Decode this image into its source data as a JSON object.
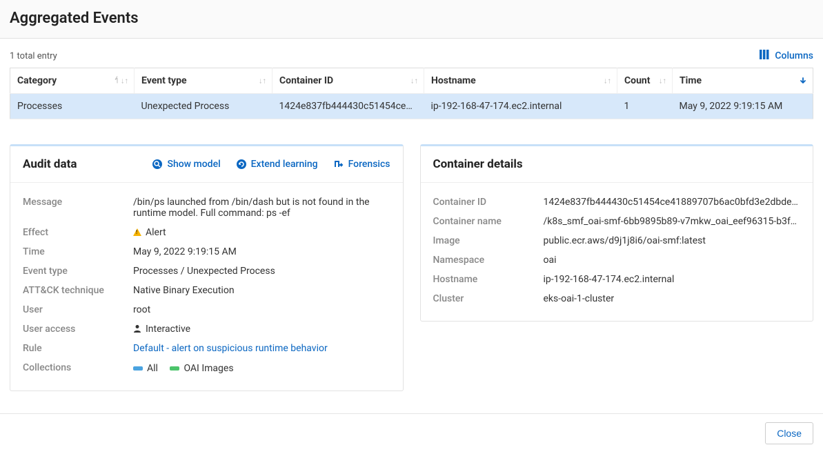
{
  "header": {
    "title": "Aggregated Events"
  },
  "summary": {
    "total_text": "1 total entry",
    "columns_label": "Columns"
  },
  "table": {
    "headers": {
      "category": "Category",
      "event_type": "Event type",
      "container_id": "Container ID",
      "hostname": "Hostname",
      "count": "Count",
      "time": "Time"
    },
    "rows": [
      {
        "category": "Processes",
        "event_type": "Unexpected Process",
        "container_id": "1424e837fb444430c51454ce…",
        "hostname": "ip-192-168-47-174.ec2.internal",
        "count": "1",
        "time": "May 9, 2022 9:19:15 AM"
      }
    ]
  },
  "audit": {
    "title": "Audit data",
    "actions": {
      "show_model": "Show model",
      "extend_learning": "Extend learning",
      "forensics": "Forensics"
    },
    "fields": {
      "message_label": "Message",
      "message": "/bin/ps launched from /bin/dash but is not found in the runtime model. Full command: ps -ef",
      "effect_label": "Effect",
      "effect": "Alert",
      "time_label": "Time",
      "time": "May 9, 2022 9:19:15 AM",
      "event_type_label": "Event type",
      "event_type": "Processes / Unexpected Process",
      "attack_label": "ATT&CK technique",
      "attack": "Native Binary Execution",
      "user_label": "User",
      "user": "root",
      "user_access_label": "User access",
      "user_access": "Interactive",
      "rule_label": "Rule",
      "rule": "Default - alert on suspicious runtime behavior",
      "collections_label": "Collections",
      "collections": {
        "all": "All",
        "oai": "OAI Images"
      }
    }
  },
  "container": {
    "title": "Container details",
    "fields": {
      "container_id_label": "Container ID",
      "container_id": "1424e837fb444430c51454ce41889707b6ac0bfd3e2dbde…",
      "container_name_label": "Container name",
      "container_name": "/k8s_smf_oai-smf-6bb9895b89-v7mkw_oai_eef96315-b3fd…",
      "image_label": "Image",
      "image": "public.ecr.aws/d9j1j8i6/oai-smf:latest",
      "namespace_label": "Namespace",
      "namespace": "oai",
      "hostname_label": "Hostname",
      "hostname": "ip-192-168-47-174.ec2.internal",
      "cluster_label": "Cluster",
      "cluster": "eks-oai-1-cluster"
    }
  },
  "footer": {
    "close": "Close"
  }
}
